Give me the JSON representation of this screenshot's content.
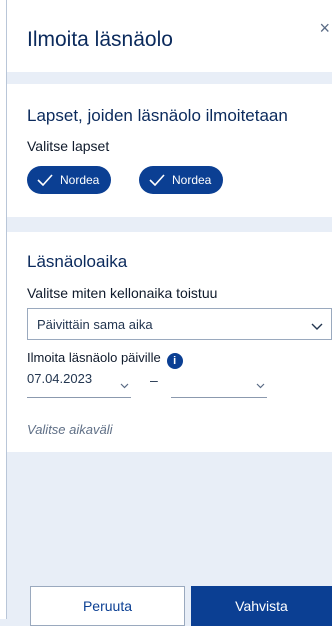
{
  "dialog": {
    "title": "Ilmoita läsnäolo",
    "close_glyph": "×"
  },
  "children_section": {
    "heading": "Lapset, joiden läsnäolo ilmoitetaan",
    "select_label": "Valitse lapset",
    "chips": [
      {
        "label": "Nordea",
        "selected": true,
        "icon": "checkmark-icon"
      },
      {
        "label": "Nordea",
        "selected": true,
        "icon": "checkmark-icon"
      }
    ]
  },
  "time_section": {
    "heading": "Läsnäoloaika",
    "repeat_label": "Valitse miten kellonaika toistuu",
    "repeat_value": "Päivittäin sama aika",
    "dates_label": "Ilmoita läsnäolo päiville",
    "info_glyph": "i",
    "start_date": "07.04.2023",
    "end_date": "",
    "range_separator": "–",
    "interval_hint": "Valitse aikaväli"
  },
  "footer": {
    "cancel_label": "Peruuta",
    "confirm_label": "Vahvista"
  },
  "colors": {
    "primary": "#0b3f93",
    "title": "#0b2a5c",
    "background": "#e8eef7"
  }
}
